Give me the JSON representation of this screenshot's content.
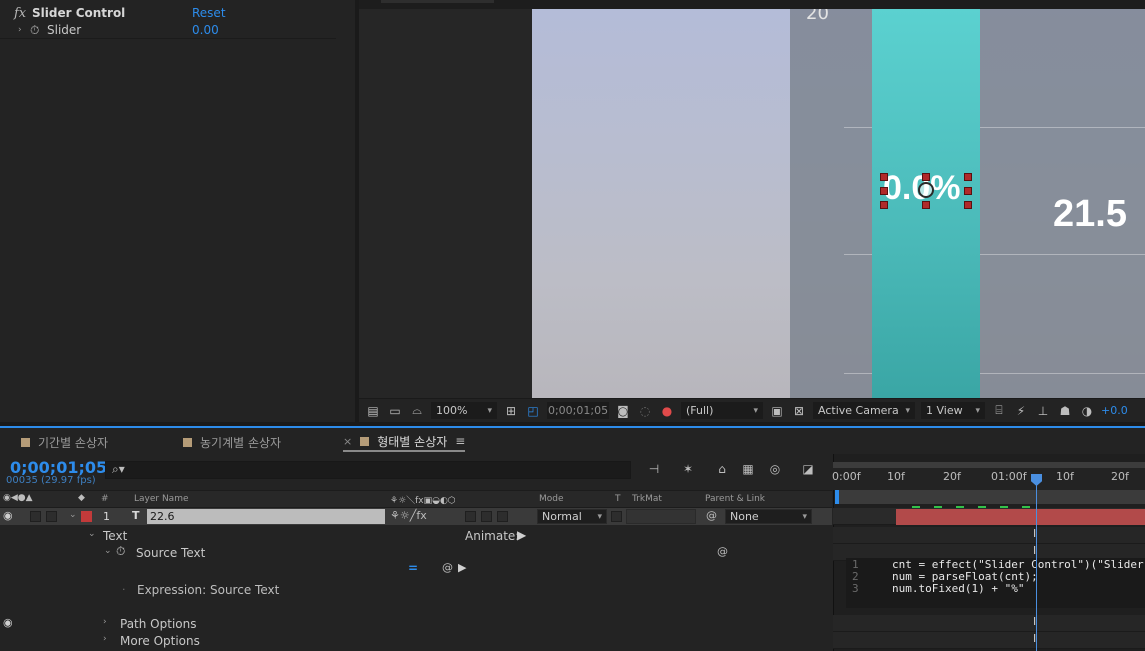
{
  "effect_controls": {
    "effect_name": "Slider Control",
    "reset_label": "Reset",
    "param_name": "Slider",
    "param_value": "0.00"
  },
  "viewer": {
    "scale_label_top": "20",
    "bar_text": "0.0%",
    "side_value": "21.5",
    "toolbar": {
      "zoom": "100%",
      "timecode": "0;00;01;05",
      "resolution": "(Full)",
      "camera": "Active Camera",
      "views": "1 View",
      "exposure": "+0.0"
    }
  },
  "tabs": [
    {
      "label": "기간별 손상자",
      "active": false
    },
    {
      "label": "농기계별 손상자",
      "active": false
    },
    {
      "label": "형태별 손상자",
      "active": true
    }
  ],
  "timeline": {
    "timecode": "0;00;01;05",
    "frame_info": "00035 (29.97 fps)",
    "columns": {
      "number": "#",
      "layer_name": "Layer Name",
      "mode": "Mode",
      "t": "T",
      "trkmat": "TrkMat",
      "parent": "Parent & Link"
    },
    "layer": {
      "index": "1",
      "type_glyph": "T",
      "name": "22.6",
      "mode": "Normal",
      "parent": "None",
      "color": "#c23a3a"
    },
    "properties": {
      "text": "Text",
      "animate": "Animate:",
      "source_text": "Source Text",
      "expression_label": "Expression: Source Text",
      "path_options": "Path Options",
      "more_options": "More Options"
    },
    "ruler": [
      "0:00f",
      "10f",
      "20f",
      "01:00f",
      "10f",
      "20f"
    ],
    "expression_code": [
      {
        "line": "1",
        "code": "cnt = effect(\"Slider Control\")(\"Slider\");"
      },
      {
        "line": "2",
        "code": "num = parseFloat(cnt);"
      },
      {
        "line": "3",
        "code": "num.toFixed(1) + \"%\""
      }
    ]
  }
}
